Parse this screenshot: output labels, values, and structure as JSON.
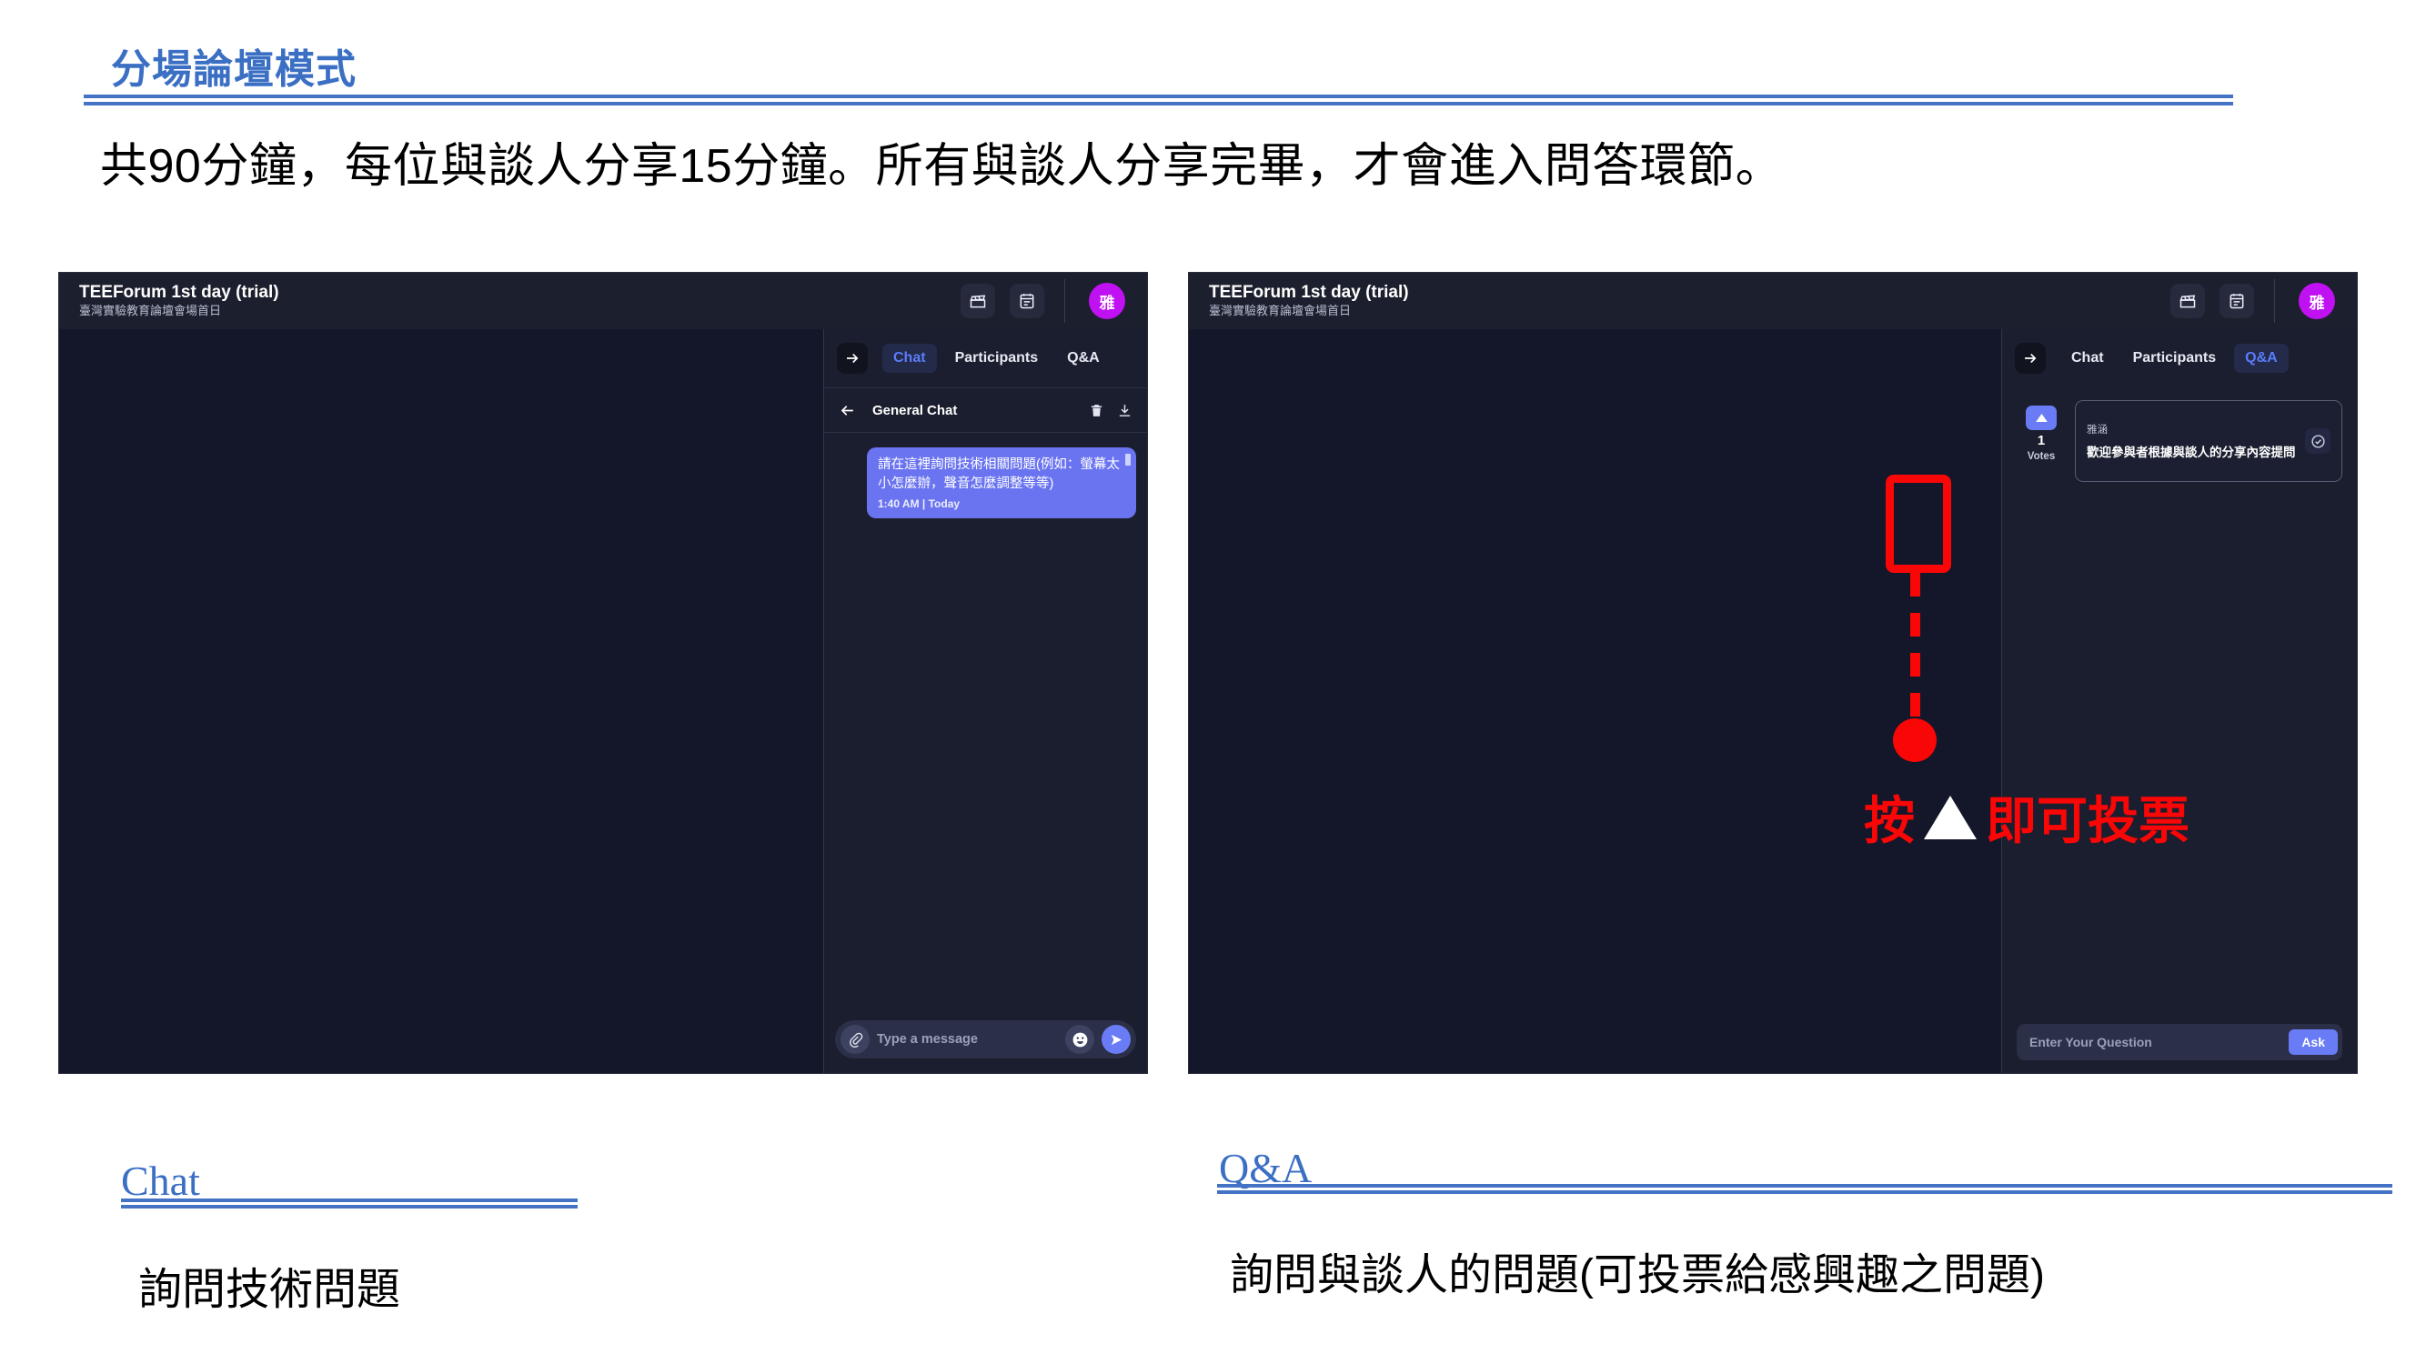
{
  "slide": {
    "title": "分場論壇模式",
    "subtitle": "共90分鐘，每位與談人分享15分鐘。所有與談人分享完畢，才會進入問答環節。",
    "accent_color": "#4472c4",
    "heading_color": "#3b6fc4"
  },
  "app": {
    "header": {
      "title": "TEEForum 1st day (trial)",
      "subtitle": "臺灣實驗教育論壇會場首日",
      "icons": [
        "clapperboard-icon",
        "agenda-icon"
      ],
      "avatar_initial": "雅",
      "avatar_color": "#c011f2"
    },
    "tabs": [
      {
        "label": "Chat"
      },
      {
        "label": "Participants"
      },
      {
        "label": "Q&A"
      }
    ]
  },
  "left_screenshot": {
    "active_tab": "Chat",
    "chat": {
      "room_title": "General Chat",
      "actions": [
        "delete-icon",
        "download-icon"
      ],
      "messages": [
        {
          "text": "請在這裡詢問技術相關問題(例如：螢幕太小怎麼辦，聲音怎麼調整等等)",
          "time": "1:40 AM | Today"
        }
      ],
      "composer": {
        "placeholder": "Type a message",
        "attach_icon": "paperclip-icon",
        "emoji_icon": "emoji-icon",
        "send_icon": "send-icon"
      }
    }
  },
  "right_screenshot": {
    "active_tab": "Q&A",
    "qa": {
      "questions": [
        {
          "votes": "1",
          "votes_label": "Votes",
          "author": "雅涵",
          "text": "歡迎參與者根據與談人的分享內容提問"
        }
      ],
      "composer": {
        "placeholder": "Enter Your Question",
        "ask_label": "Ask"
      }
    },
    "annotation": {
      "text_before": "按",
      "text_after": "即可投票",
      "color": "#f90606"
    }
  },
  "captions": {
    "left": {
      "heading": "Chat",
      "body": "詢問技術問題"
    },
    "right": {
      "heading": "Q&A",
      "body": "詢問與談人的問題(可投票給感興趣之問題)"
    }
  }
}
